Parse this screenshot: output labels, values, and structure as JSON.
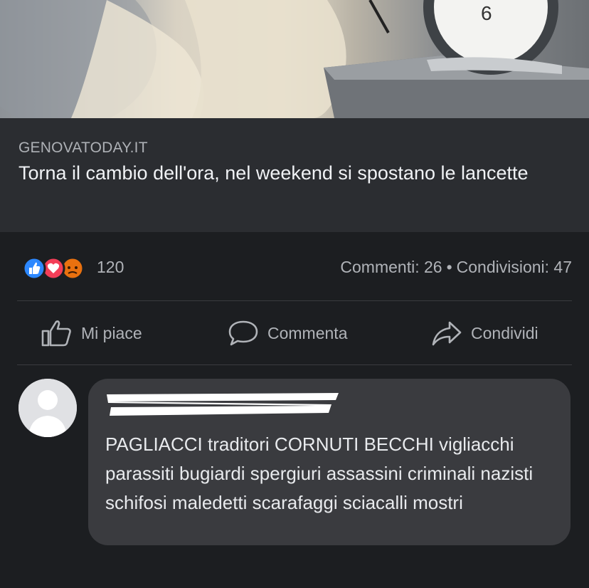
{
  "post": {
    "domain": "GENOVATODAY.IT",
    "headline": "Torna il cambio dell'ora, nel weekend si spostano le lancette"
  },
  "reactions": {
    "icons": [
      "like-icon",
      "love-icon",
      "angry-icon"
    ],
    "count": "120",
    "comments_label": "Commenti: 26",
    "separator": "•",
    "shares_label": "Condivisioni: 47"
  },
  "actions": {
    "like": "Mi piace",
    "comment": "Commenta",
    "share": "Condividi"
  },
  "comment": {
    "text": "PAGLIACCI traditori CORNUTI BECCHI vigliacchi parassiti bugiardi spergiuri assassini criminali nazisti schifosi maledetti scarafaggi sciacalli mostri"
  },
  "colors": {
    "background": "#1c1e21",
    "card": "#2b2d31",
    "bubble": "#3a3b3f",
    "like": "#2d88ff",
    "love": "#f33e58",
    "angry": "#e9710f"
  }
}
